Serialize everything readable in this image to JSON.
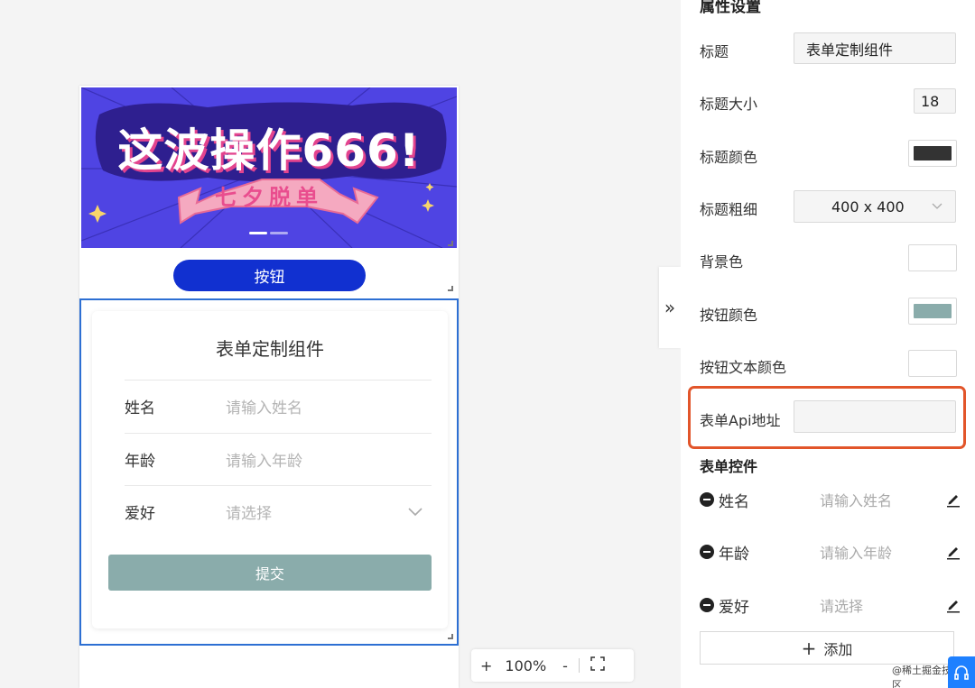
{
  "canvas": {
    "banner": {
      "title": "这波操作666!",
      "subtitle": "七夕脱单"
    },
    "button_label": "按钮",
    "form": {
      "title": "表单定制组件",
      "fields": [
        {
          "label": "姓名",
          "placeholder": "请输入姓名"
        },
        {
          "label": "年龄",
          "placeholder": "请输入年龄"
        },
        {
          "label": "爱好",
          "placeholder": "请选择"
        }
      ],
      "submit_label": "提交"
    }
  },
  "zoom": {
    "plus": "+",
    "level": "100%",
    "minus": "-"
  },
  "collapse_glyph": "»",
  "panel": {
    "title": "属性设置",
    "title_label": "标题",
    "title_value": "表单定制组件",
    "title_size_label": "标题大小",
    "title_size_value": "18",
    "title_color_label": "标题颜色",
    "title_color": "#333333",
    "title_weight_label": "标题粗细",
    "title_weight_value": "400 x 400",
    "bg_color_label": "背景色",
    "bg_color": "#ffffff",
    "btn_color_label": "按钮颜色",
    "btn_color": "#8aacab",
    "btn_text_color_label": "按钮文本颜色",
    "btn_text_color": "#ffffff",
    "api_label": "表单Api地址",
    "api_value": "",
    "controls_label": "表单控件",
    "controls": [
      {
        "name": "姓名",
        "placeholder": "请输入姓名"
      },
      {
        "name": "年龄",
        "placeholder": "请输入年龄"
      },
      {
        "name": "爱好",
        "placeholder": "请选择"
      }
    ],
    "add_label": "添加"
  },
  "watermark": "@稀土掘金技术社区",
  "colors": {
    "accent_blue": "#1130d0",
    "selection": "#2d6fd3",
    "highlight": "#e2552a",
    "banner_bg": "#4f44e3"
  }
}
